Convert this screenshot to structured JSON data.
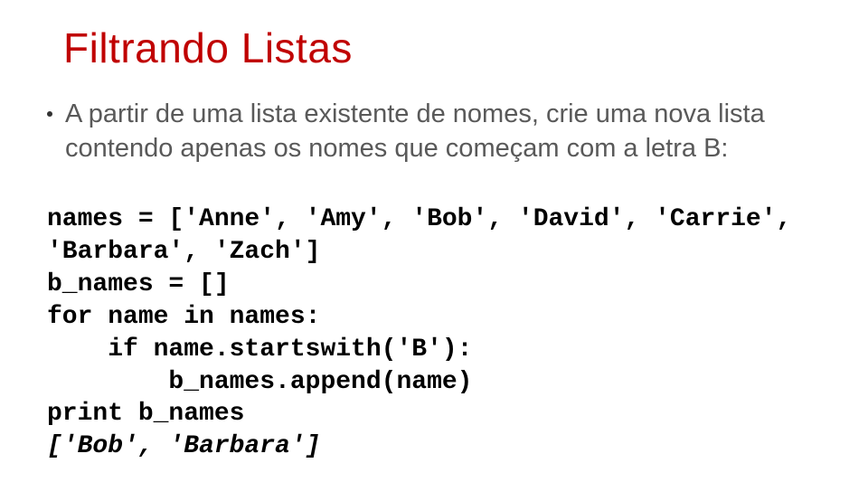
{
  "title": "Filtrando Listas",
  "bullet": "A partir de uma lista existente de nomes, crie uma nova lista contendo apenas os nomes que começam com a letra B:",
  "code": {
    "l1": "names = ['Anne', 'Amy', 'Bob', 'David', 'Carrie',",
    "l2": "'Barbara', 'Zach']",
    "l3": "b_names = []",
    "l4": "for name in names:",
    "l5": "    if name.startswith('B'):",
    "l6": "        b_names.append(name)",
    "l7": "print b_names"
  },
  "output": "['Bob', 'Barbara']"
}
